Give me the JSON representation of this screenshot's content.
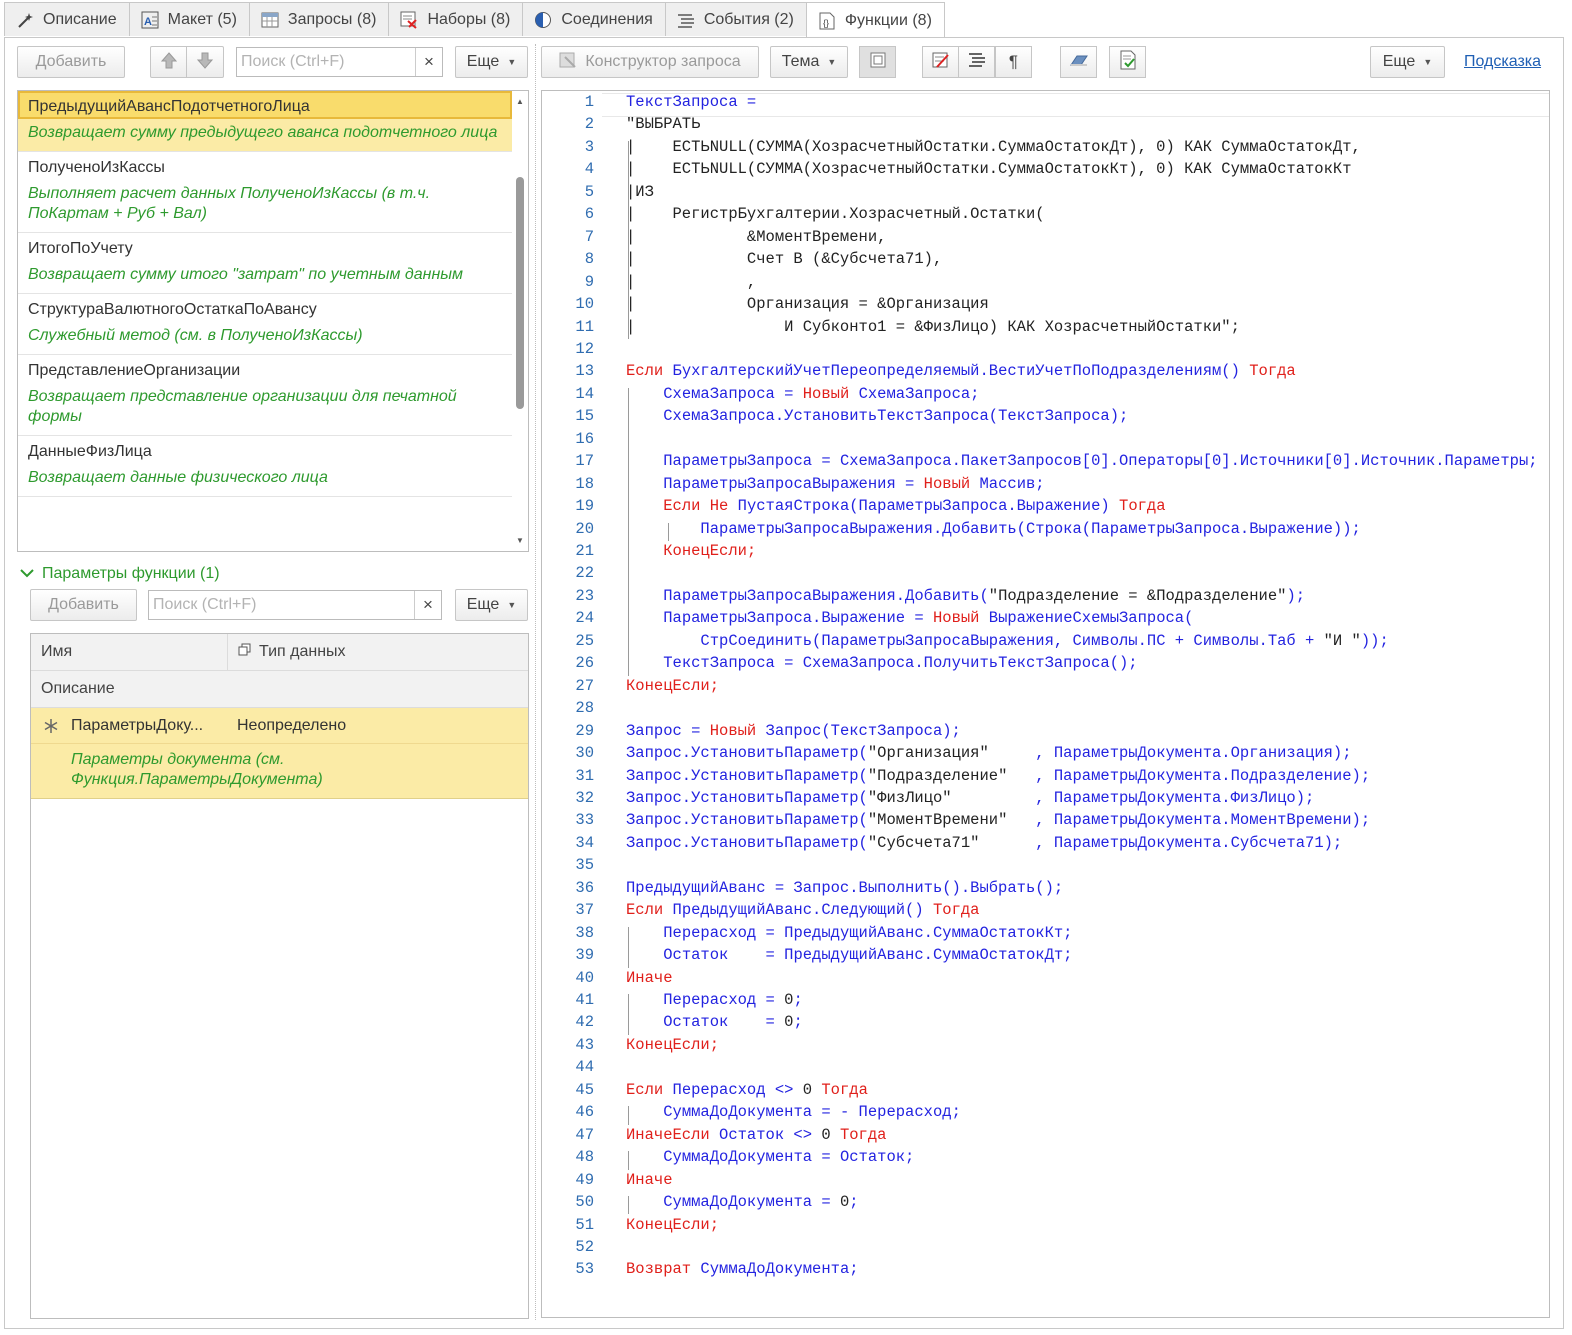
{
  "tabs": [
    {
      "label": "Описание",
      "icon": "wand-icon"
    },
    {
      "label": "Макет (5)",
      "icon": "layout-icon"
    },
    {
      "label": "Запросы (8)",
      "icon": "table-icon"
    },
    {
      "label": "Наборы (8)",
      "icon": "sets-icon"
    },
    {
      "label": "Соединения",
      "icon": "half-circle-icon"
    },
    {
      "label": "События (2)",
      "icon": "events-icon"
    },
    {
      "label": "Функции (8)",
      "icon": "function-icon"
    }
  ],
  "left_toolbar": {
    "add_label": "Добавить",
    "search_placeholder": "Поиск (Ctrl+F)",
    "more_label": "Еще"
  },
  "functions": [
    {
      "name": "ПредыдущийАвансПодотчетногоЛица",
      "description": "Возвращает сумму предыдущего аванса подотчетного лица"
    },
    {
      "name": "ПолученоИзКассы",
      "description": "Выполняет расчет данных ПолученоИзКассы (в т.ч. ПоКартам + Руб + Вал)"
    },
    {
      "name": "ИтогоПоУчету",
      "description": "Возвращает сумму итого \"затрат\" по учетным данным"
    },
    {
      "name": "СтруктураВалютногоОстаткаПоАвансу",
      "description": "Служебный метод (см. в ПолученоИзКассы)"
    },
    {
      "name": "ПредставлениеОрганизации",
      "description": "Возвращает представление организации для печатной формы"
    },
    {
      "name": "ДанныеФизЛица",
      "description": "Возвращает данные физического лица"
    }
  ],
  "params": {
    "title": "Параметры функции (1)",
    "add_label": "Добавить",
    "search_placeholder": "Поиск (Ctrl+F)",
    "more_label": "Еще",
    "col_name": "Имя",
    "col_type": "Тип данных",
    "col_desc": "Описание",
    "row": {
      "name": "ПараметрыДоку...",
      "type": "Неопределено",
      "description": "Параметры документа (см. Функция.ПараметрыДокумента)"
    }
  },
  "code_toolbar": {
    "constructor_label": "Конструктор запроса",
    "theme_label": "Тема",
    "more_label": "Еще",
    "help_label": "Подсказка"
  },
  "colors": {
    "keyword": "#e0201b",
    "identifier": "#2323e0",
    "line_number": "#2f6cb0",
    "selection": "#fbeba6",
    "description": "#2e9a2e"
  },
  "code_lines": [
    "@iТекстЗапроса =",
    "\"ВЫБРАТЬ",
    "|    ЕСТЬNULL(СУММА(ХозрасчетныйОстатки.СуммаОстатокДт), 0) КАК СуммаОстатокДт,",
    "|    ЕСТЬNULL(СУММА(ХозрасчетныйОстатки.СуммаОстатокКт), 0) КАК СуммаОстатокКт",
    "|ИЗ",
    "|    РегистрБухгалтерии.Хозрасчетный.Остатки(",
    "|            &МоментВремени,",
    "|            Счет В (&Субсчета71),",
    "|            ,",
    "|            Организация = &Организация",
    "|                И Субконто1 = &ФизЛицо) КАК ХозрасчетныйОстатки\";",
    "",
    "@kЕсли @iБухгалтерскийУчетПереопределяемый.ВестиУчетПоПодразделениям() @kТогда",
    "    @iСхемаЗапроса = @kНовый @iСхемаЗапроса;",
    "    @iСхемаЗапроса.УстановитьТекстЗапроса(ТекстЗапроса);",
    "",
    "    @iПараметрыЗапроса = СхемаЗапроса.ПакетЗапросов[0].Операторы[0].Источники[0].Источник.Параметры;",
    "    @iПараметрыЗапросаВыражения = @kНовый @iМассив;",
    "    @kЕсли Не @iПустаяСтрока(ПараметрыЗапроса.Выражение) @kТогда",
    "        @iПараметрыЗапросаВыражения.Добавить(Строка(ПараметрыЗапроса.Выражение));",
    "    @kКонецЕсли;",
    "",
    "    @iПараметрыЗапросаВыражения.Добавить(@t\"Подразделение = &Подразделение\"@i);",
    "    @iПараметрыЗапроса.Выражение = @kНовый @iВыражениеСхемыЗапроса(",
    "        @iСтрСоединить(ПараметрыЗапросаВыражения, Символы.ПС + Символы.Таб + @t\"И \"@i));",
    "    @iТекстЗапроса = СхемаЗапроса.ПолучитьТекстЗапроса();",
    "@kКонецЕсли;",
    "",
    "@iЗапрос = @kНовый @iЗапрос(ТекстЗапроса);",
    "@iЗапрос.УстановитьПараметр(@t\"Организация\"     @i, ПараметрыДокумента.Организация);",
    "@iЗапрос.УстановитьПараметр(@t\"Подразделение\"   @i, ПараметрыДокумента.Подразделение);",
    "@iЗапрос.УстановитьПараметр(@t\"ФизЛицо\"         @i, ПараметрыДокумента.ФизЛицо);",
    "@iЗапрос.УстановитьПараметр(@t\"МоментВремени\"   @i, ПараметрыДокумента.МоментВремени);",
    "@iЗапрос.УстановитьПараметр(@t\"Субсчета71\"      @i, ПараметрыДокумента.Субсчета71);",
    "",
    "@iПредыдущийАванс = Запрос.Выполнить().Выбрать();",
    "@kЕсли @iПредыдущийАванс.Следующий() @kТогда",
    "    @iПерерасход = ПредыдущийАванс.СуммаОстатокКт;",
    "    @iОстаток    = ПредыдущийАванс.СуммаОстатокДт;",
    "@kИначе",
    "    @iПерерасход = @t0@i;",
    "    @iОстаток    = @t0@i;",
    "@kКонецЕсли;",
    "",
    "@kЕсли @iПерерасход <> @t0 @kТогда",
    "    @iСуммаДоДокумента = - Перерасход;",
    "@kИначеЕсли @iОстаток <> @t0 @kТогда",
    "    @iСуммаДоДокумента = Остаток;",
    "@kИначе",
    "    @iСуммаДоДокумента = @t0@i;",
    "@kКонецЕсли;",
    "",
    "@kВозврат @iСуммаДоДокумента;"
  ]
}
